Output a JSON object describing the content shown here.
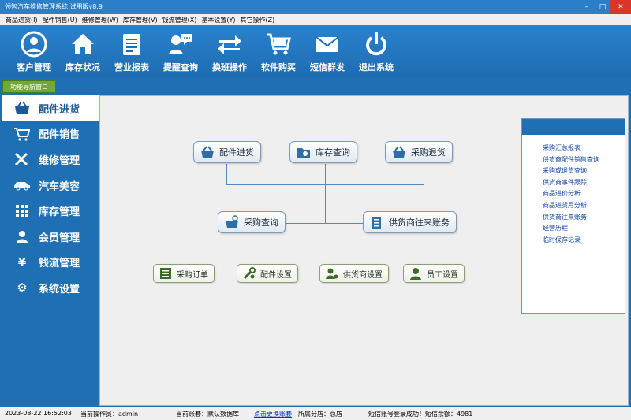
{
  "window": {
    "title": "领智汽车维修管理系统 试用版v8.9"
  },
  "menu": [
    "商品进货(I)",
    "配件销售(U)",
    "维修管理(W)",
    "库存管理(V)",
    "钱流管理(X)",
    "基本设置(Y)",
    "其它操作(Z)"
  ],
  "toolbar": [
    {
      "label": "客户管理",
      "icon": "user-icon"
    },
    {
      "label": "库存状况",
      "icon": "home-icon"
    },
    {
      "label": "营业报表",
      "icon": "report-icon"
    },
    {
      "label": "提醒查询",
      "icon": "chat-icon"
    },
    {
      "label": "换班操作",
      "icon": "swap-icon"
    },
    {
      "label": "软件购买",
      "icon": "cart-icon"
    },
    {
      "label": "短信群发",
      "icon": "mail-icon"
    },
    {
      "label": "退出系统",
      "icon": "power-icon"
    }
  ],
  "nav_tab": "功能导航窗口",
  "sidebar": [
    {
      "label": "配件进货",
      "icon": "basket-icon",
      "active": true
    },
    {
      "label": "配件销售",
      "icon": "cart-icon"
    },
    {
      "label": "维修管理",
      "icon": "tools-icon"
    },
    {
      "label": "汽车美容",
      "icon": "car-icon"
    },
    {
      "label": "库存管理",
      "icon": "grid-icon"
    },
    {
      "label": "会员管理",
      "icon": "person-icon"
    },
    {
      "label": "钱流管理",
      "icon": "yen-icon"
    },
    {
      "label": "系统设置",
      "icon": "gear-icon"
    }
  ],
  "flow": {
    "purchase_in": "配件进货",
    "stock_query": "库存查询",
    "purchase_return": "采购退货",
    "purchase_query": "采购查询",
    "supplier_account": "供货商往来账务"
  },
  "settings_buttons": [
    "采购订单",
    "配件设置",
    "供货商设置",
    "员工设置"
  ],
  "report_links": [
    "采购汇总报表",
    "供货商配件销售查询",
    "采购或退货查询",
    "供货商事件跟踪",
    "商品进价分析",
    "商品进货月分析",
    "供货商往来账务",
    "经营历程",
    "临时保存记录"
  ],
  "status": {
    "datetime": "2023-08-22 16:52:03",
    "operator": "当前操作员：admin",
    "account": "当前账套：默认数据库",
    "switch_link": "点击更换账套",
    "branch": "所属分店：总店",
    "sms": "短信账号登录成功！短信余额：4981"
  },
  "colors": {
    "primary": "#1f6fb5",
    "nav_tab": "#72a83a",
    "close": "#d9352b",
    "link": "#1144aa"
  }
}
